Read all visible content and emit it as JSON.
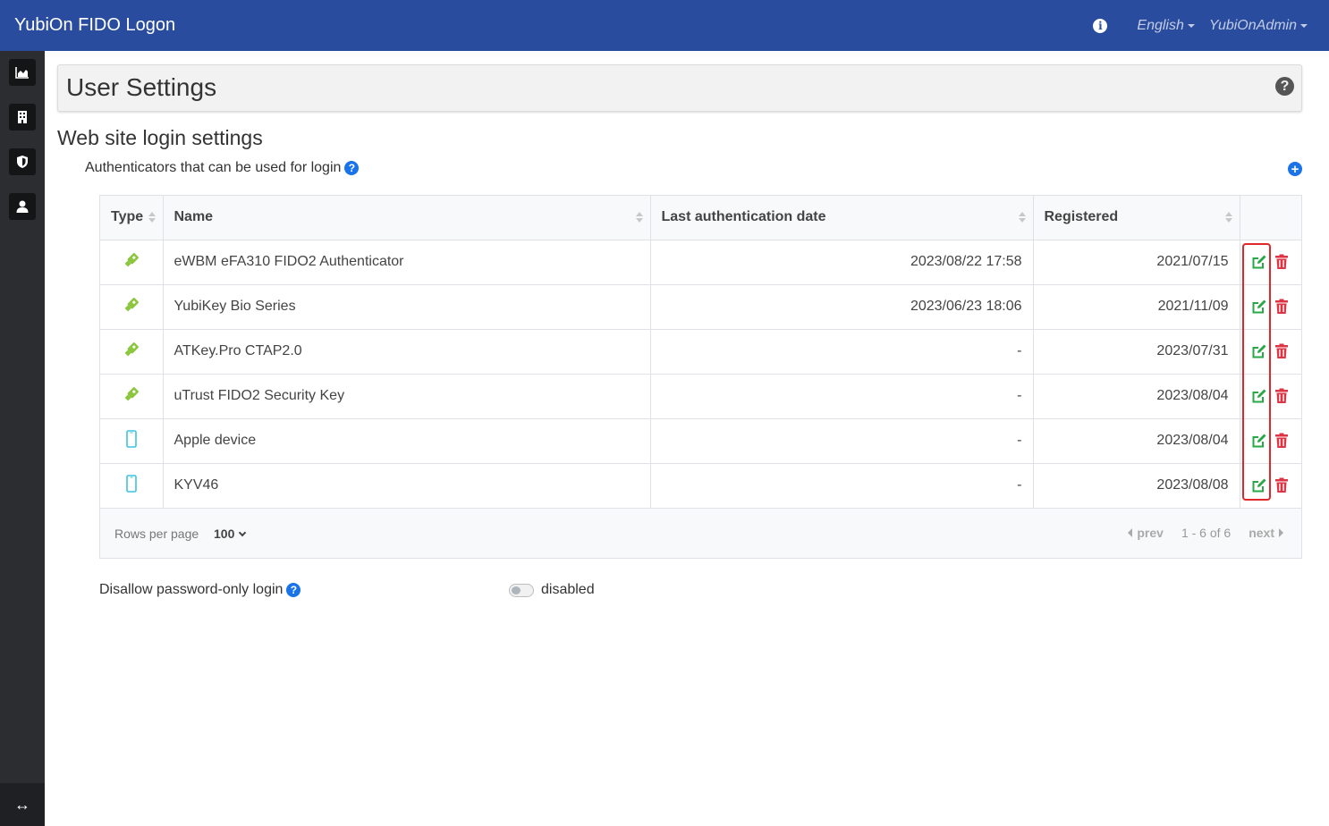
{
  "navbar": {
    "brand": "YubiOn FIDO Logon",
    "language": "English",
    "user": "YubiOnAdmin",
    "info_icon": "i"
  },
  "sidebar": {
    "items": [
      {
        "icon": "area-chart-icon"
      },
      {
        "icon": "building-icon"
      },
      {
        "icon": "shield-icon"
      },
      {
        "icon": "user-icon"
      }
    ],
    "toggle_icon": "↔"
  },
  "page": {
    "title": "User Settings",
    "help": "?"
  },
  "section": {
    "title": "Web site login settings",
    "subtitle": "Authenticators that can be used for login",
    "help": "?",
    "add": "+"
  },
  "table": {
    "headers": [
      "Type",
      "Name",
      "Last authentication date",
      "Registered"
    ],
    "rows": [
      {
        "type": "security-key",
        "name": "eWBM eFA310 FIDO2 Authenticator",
        "last_auth": "2023/08/22 17:58",
        "registered": "2021/07/15"
      },
      {
        "type": "security-key",
        "name": "YubiKey Bio Series",
        "last_auth": "2023/06/23 18:06",
        "registered": "2021/11/09"
      },
      {
        "type": "security-key",
        "name": "ATKey.Pro CTAP2.0",
        "last_auth": "-",
        "registered": "2023/07/31"
      },
      {
        "type": "security-key",
        "name": "uTrust FIDO2 Security Key",
        "last_auth": "-",
        "registered": "2023/08/04"
      },
      {
        "type": "mobile-device",
        "name": "Apple device",
        "last_auth": "-",
        "registered": "2023/08/04"
      },
      {
        "type": "mobile-device",
        "name": "KYV46",
        "last_auth": "-",
        "registered": "2023/08/08"
      }
    ],
    "footer": {
      "rows_per_page_label": "Rows per page",
      "rows_per_page_value": "100",
      "prev": "prev",
      "range": "1 - 6 of 6",
      "next": "next"
    }
  },
  "password_only": {
    "label": "Disallow password-only login",
    "help": "?",
    "state": "disabled"
  },
  "colors": {
    "navbar": "#2a4c9e",
    "key_icon": "#8cc63f",
    "mobile_icon": "#3bc3e0",
    "edit": "#28a745",
    "delete": "#dc3545",
    "highlight": "#e0282a"
  }
}
